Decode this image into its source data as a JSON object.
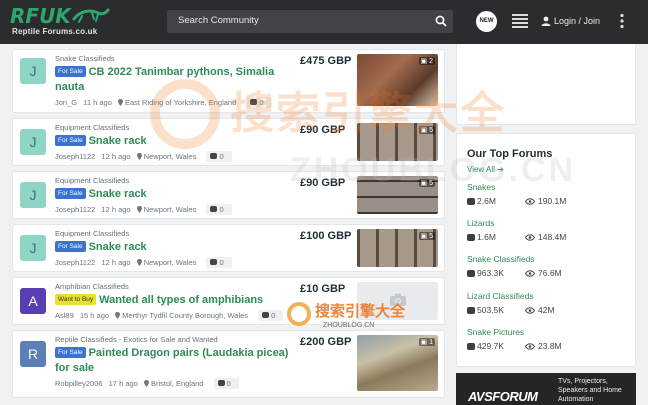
{
  "header": {
    "logo_main": "RFUK",
    "logo_sub": "Reptile Forums.co.uk",
    "search_placeholder": "Search Community",
    "new_label": "NEW",
    "login_label": "Login / Join"
  },
  "listings": [
    {
      "category": "Snake Classifieds",
      "badge": "For Sale",
      "title": "CB 2022 Tanimbar pythons, Simalia nauta",
      "author": "Jon_G",
      "time": "11 h ago",
      "location": "East Riding of Yorkshire, England",
      "comments": "0",
      "price": "£475 GBP",
      "avatar": "J",
      "photo_count": "2"
    },
    {
      "category": "Equipment Classifieds",
      "badge": "For Sale",
      "title": "Snake rack",
      "author": "Joseph1122",
      "time": "12 h ago",
      "location": "Newport, Wales",
      "comments": "0",
      "price": "£90 GBP",
      "avatar": "J",
      "photo_count": "5"
    },
    {
      "category": "Equipment Classifieds",
      "badge": "For Sale",
      "title": "Snake rack",
      "author": "Joseph1122",
      "time": "12 h ago",
      "location": "Newport, Wales",
      "comments": "0",
      "price": "£90 GBP",
      "avatar": "J",
      "photo_count": "5"
    },
    {
      "category": "Equipment Classifieds",
      "badge": "For Sale",
      "title": "Snake rack",
      "author": "Joseph1122",
      "time": "12 h ago",
      "location": "Newport, Wales",
      "comments": "0",
      "price": "£100 GBP",
      "avatar": "J",
      "photo_count": "5"
    },
    {
      "category": "Amphibian Classifieds",
      "badge": "Want to Buy",
      "title": "Wanted all types of amphibians",
      "author": "Asl89",
      "time": "15 h ago",
      "location": "Merthyr Tydfil County Borough, Wales",
      "comments": "0",
      "price": "£10 GBP",
      "avatar": "A",
      "photo_count": ""
    },
    {
      "category": "Reptile Classifieds - Exotics for Sale and Wanted",
      "badge": "For Sale",
      "title": "Painted Dragon pairs (Laudakia picea) for sale",
      "author": "Robpilley2006",
      "time": "17 h ago",
      "location": "Bristol, England",
      "comments": "0",
      "price": "£200 GBP",
      "avatar": "R",
      "photo_count": "1"
    }
  ],
  "sidebar": {
    "heading": "Our Top Forums",
    "view_all": "View All",
    "forums": [
      {
        "name": "Snakes",
        "posts": "2.6M",
        "views": "190.1M"
      },
      {
        "name": "Lizards",
        "posts": "1.6M",
        "views": "148.4M"
      },
      {
        "name": "Snake Classifieds",
        "posts": "963.3K",
        "views": "76.6M"
      },
      {
        "name": "Lizard Classifieds",
        "posts": "503.5K",
        "views": "42M"
      },
      {
        "name": "Snake Pictures",
        "posts": "429.7K",
        "views": "23.8M"
      }
    ]
  },
  "ad": {
    "brand": "AVSFORUM",
    "text": "TVs, Projectors, Speakers and Home Automation"
  },
  "watermark": {
    "cn": "搜索引擎大全",
    "en": "ZHOUBLOG.CN"
  },
  "colors": {
    "header_bg": "#2a2c30",
    "accent_green": "#2e8b57",
    "badge_blue": "#3a73d1",
    "badge_yellow": "#e9df2c"
  }
}
